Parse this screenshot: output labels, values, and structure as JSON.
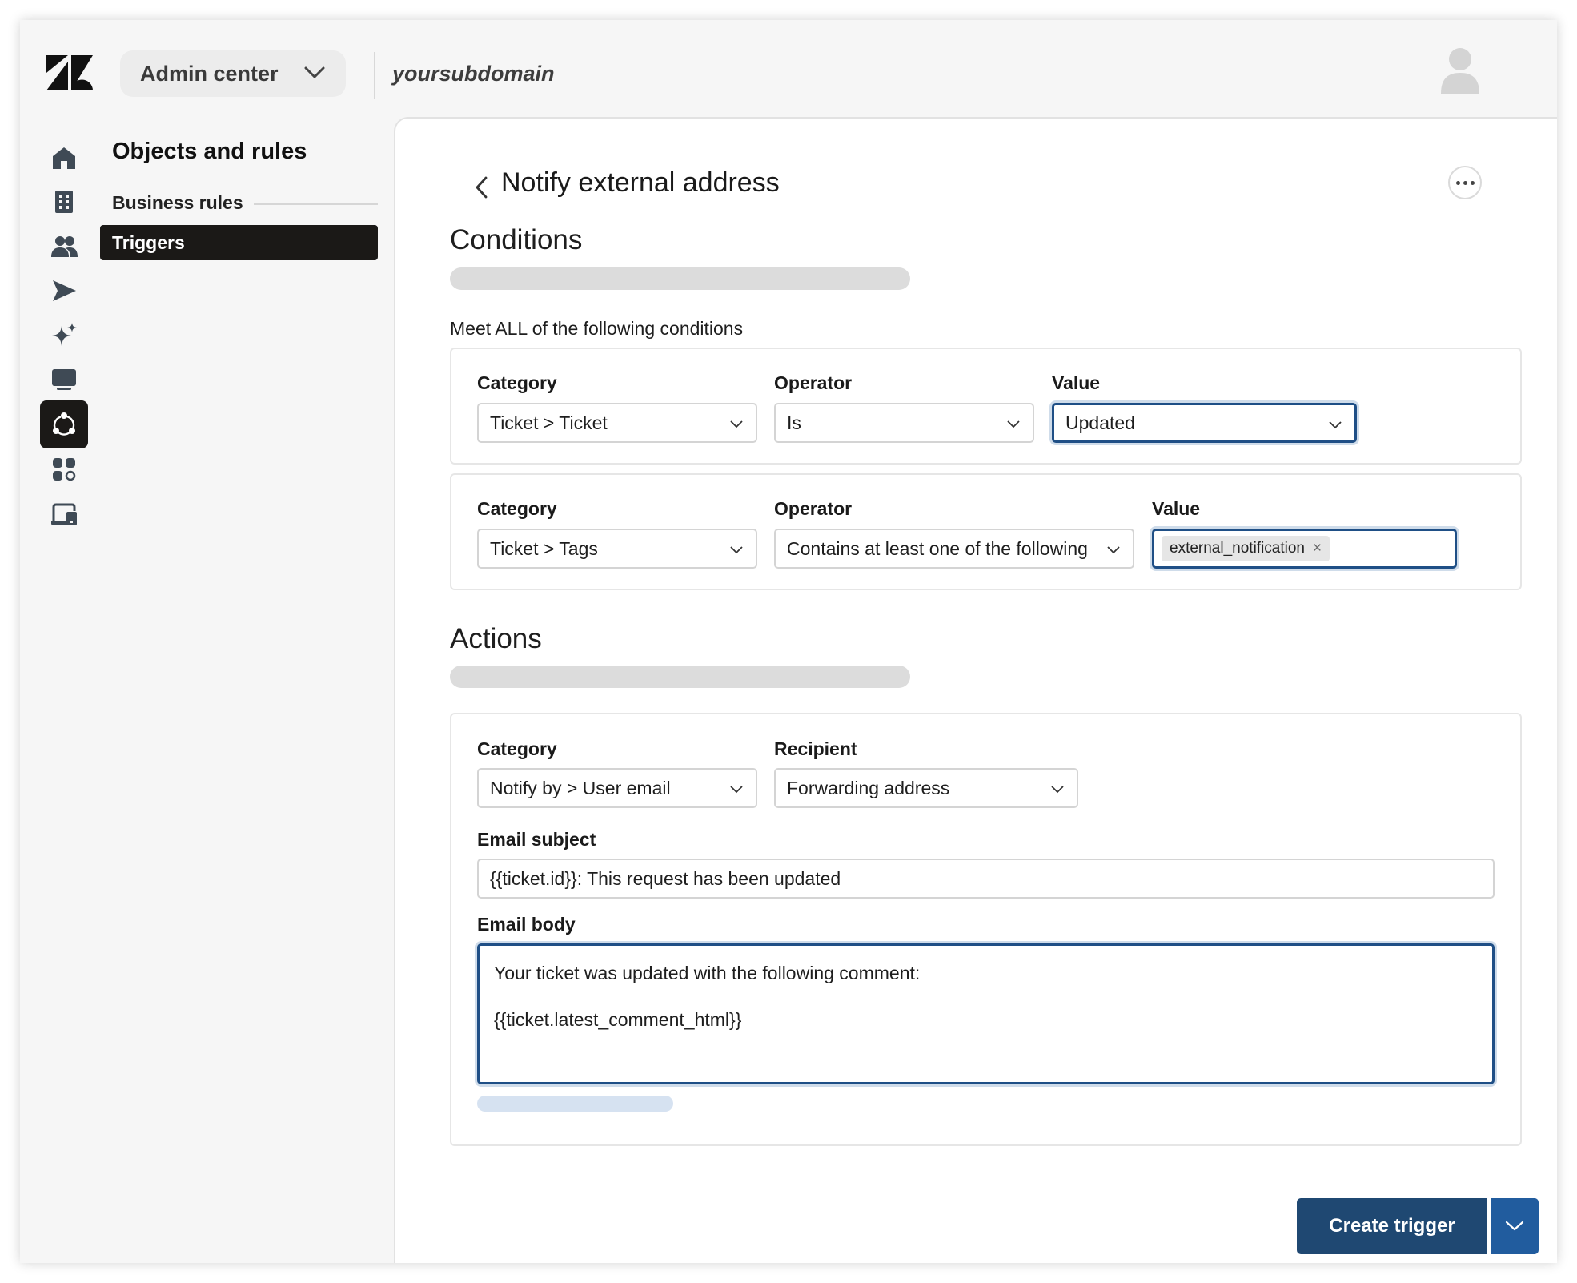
{
  "header": {
    "product_switcher_label": "Admin center",
    "subdomain": "yoursubdomain"
  },
  "rail": {
    "items": [
      "home-icon",
      "organization-icon",
      "people-icon",
      "channels-icon",
      "ai-icon",
      "workspaces-icon",
      "objects-rules-icon",
      "apps-icon",
      "account-icon"
    ],
    "active": "objects-rules-icon"
  },
  "nav": {
    "title": "Objects and rules",
    "section": "Business rules",
    "active_item": "Triggers"
  },
  "page": {
    "title": "Notify external address"
  },
  "conditions": {
    "heading": "Conditions",
    "meet_label": "Meet ALL of the following conditions",
    "rows": [
      {
        "category_label": "Category",
        "category_value": "Ticket > Ticket",
        "operator_label": "Operator",
        "operator_value": "Is",
        "value_label": "Value",
        "value_value": "Updated"
      },
      {
        "category_label": "Category",
        "category_value": "Ticket > Tags",
        "operator_label": "Operator",
        "operator_value": "Contains at least one of the following",
        "value_label": "Value",
        "value_tag": "external_notification",
        "value_tag_remove": "×"
      }
    ]
  },
  "actions": {
    "heading": "Actions",
    "category_label": "Category",
    "category_value": "Notify by > User email",
    "recipient_label": "Recipient",
    "recipient_value": "Forwarding address",
    "email_subject_label": "Email subject",
    "email_subject_value": "{{ticket.id}}: This request has been updated",
    "email_body_label": "Email body",
    "email_body_line1": "Your ticket was updated with the following comment:",
    "email_body_line2": "{{ticket.latest_comment_html}}"
  },
  "footer": {
    "create_button_label": "Create trigger"
  },
  "colors": {
    "primary": "#1f4872",
    "focus": "#1f4f86",
    "nav_active": "#1b1917"
  }
}
